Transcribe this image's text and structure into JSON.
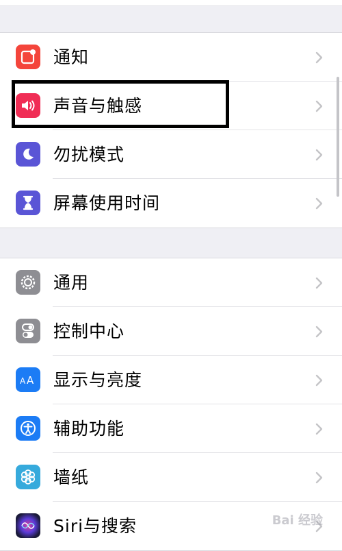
{
  "groups": [
    {
      "rows": [
        {
          "label": "通知",
          "icon": "notifications-icon",
          "color": "#f4453b"
        },
        {
          "label": "声音与触感",
          "icon": "speaker-icon",
          "color": "#f02d55"
        },
        {
          "label": "勿扰模式",
          "icon": "moon-icon",
          "color": "#5a55d6"
        },
        {
          "label": "屏幕使用时间",
          "icon": "hourglass-icon",
          "color": "#5a55d6"
        }
      ]
    },
    {
      "rows": [
        {
          "label": "通用",
          "icon": "gear-icon",
          "color": "#8e8e93"
        },
        {
          "label": "控制中心",
          "icon": "toggles-icon",
          "color": "#8e8e93"
        },
        {
          "label": "显示与亮度",
          "icon": "text-size-icon",
          "color": "#1c7cf5"
        },
        {
          "label": "辅助功能",
          "icon": "accessibility-icon",
          "color": "#1c7cf5"
        },
        {
          "label": "墙纸",
          "icon": "wallpaper-icon",
          "color": "#36aadc"
        },
        {
          "label": "Siri与搜索",
          "icon": "siri-icon",
          "color": "#1b1b3a"
        }
      ]
    }
  ],
  "watermark": "Bai 经验"
}
